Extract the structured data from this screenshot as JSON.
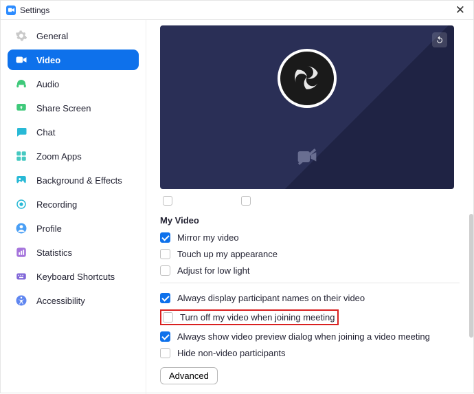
{
  "window": {
    "title": "Settings"
  },
  "sidebar": {
    "items": [
      {
        "label": "General"
      },
      {
        "label": "Video"
      },
      {
        "label": "Audio"
      },
      {
        "label": "Share Screen"
      },
      {
        "label": "Chat"
      },
      {
        "label": "Zoom Apps"
      },
      {
        "label": "Background & Effects"
      },
      {
        "label": "Recording"
      },
      {
        "label": "Profile"
      },
      {
        "label": "Statistics"
      },
      {
        "label": "Keyboard Shortcuts"
      },
      {
        "label": "Accessibility"
      }
    ],
    "selected_index": 1
  },
  "video_settings": {
    "section_title": "My Video",
    "options_a": [
      {
        "label": "Mirror my video",
        "checked": true
      },
      {
        "label": "Touch up my appearance",
        "checked": false
      },
      {
        "label": "Adjust for low light",
        "checked": false
      }
    ],
    "options_b": [
      {
        "label": "Always display participant names on their video",
        "checked": true,
        "highlight": false
      },
      {
        "label": "Turn off my video when joining meeting",
        "checked": false,
        "highlight": true
      },
      {
        "label": "Always show video preview dialog when joining a video meeting",
        "checked": true,
        "highlight": false
      },
      {
        "label": "Hide non-video participants",
        "checked": false,
        "highlight": false
      }
    ],
    "advanced_label": "Advanced"
  },
  "colors": {
    "accent": "#0e71eb",
    "highlight": "#d92020"
  }
}
